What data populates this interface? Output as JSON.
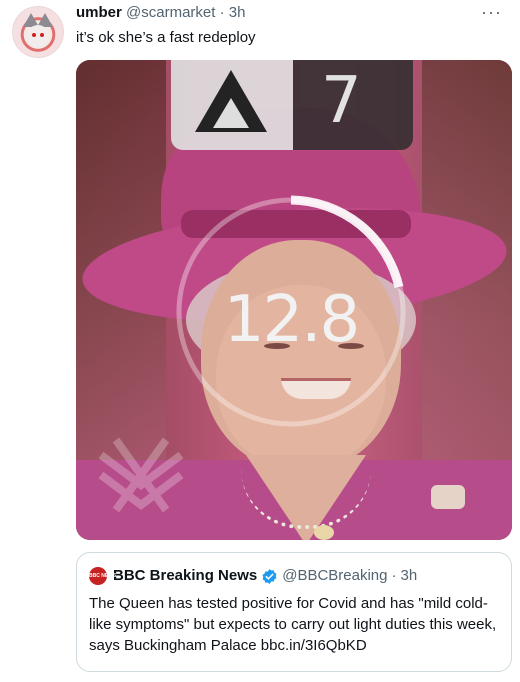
{
  "tweet": {
    "name": "umber",
    "handle": "@scarmarket",
    "separator": "·",
    "time": "3h",
    "more_label": "···",
    "text": "it’s ok she’s a fast redeploy"
  },
  "media": {
    "overlay_number": "7",
    "counter": "12.8"
  },
  "quote": {
    "logo_text": "BBC NEWS",
    "name": "BBC Breaking News",
    "handle": "@BBCBreaking",
    "separator": "·",
    "time": "3h",
    "text": "The Queen has tested positive for Covid and has \"mild cold-like symptoms\" but expects to carry out light duties this week, says Buckingham Palace bbc.in/3I6QbKD"
  },
  "colors": {
    "verified": "#1d9bf0",
    "secondary_text": "#536471",
    "border": "#cfd9de"
  }
}
